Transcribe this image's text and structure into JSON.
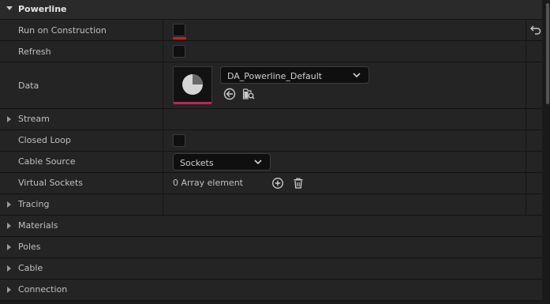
{
  "section": {
    "title": "Powerline"
  },
  "rows": {
    "run_on_construction": "Run on Construction",
    "refresh": "Refresh",
    "data": "Data",
    "stream": "Stream",
    "closed_loop": "Closed Loop",
    "cable_source": "Cable Source",
    "virtual_sockets": "Virtual Sockets",
    "tracing": "Tracing",
    "materials": "Materials",
    "poles": "Poles",
    "cable": "Cable",
    "connection": "Connection"
  },
  "values": {
    "data_asset": "DA_Powerline_Default",
    "cable_source": "Sockets",
    "virtual_sockets_count": "0 Array element",
    "run_on_construction_checked": false,
    "refresh_checked": false,
    "closed_loop_checked": false
  },
  "icons": {
    "collapse": "chevron-down-icon",
    "expand": "triangle-right-icon",
    "reset": "reset-to-default-icon",
    "use_selected": "arrow-left-circle-icon",
    "browse": "browse-folder-icon",
    "add": "plus-circle-icon",
    "delete": "trash-icon"
  },
  "colors": {
    "accent_red": "#d01b1b",
    "asset_bar": "#b5285a"
  }
}
